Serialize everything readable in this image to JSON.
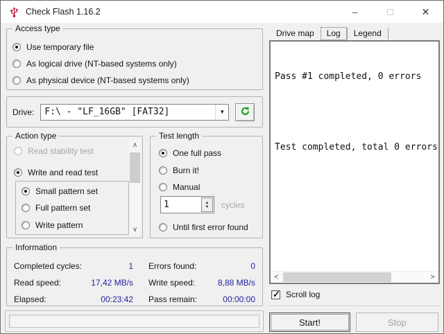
{
  "window": {
    "title": "Check Flash 1.16.2"
  },
  "icons": {
    "minimize": "–",
    "close": "✕",
    "dropdown": "▼",
    "spin_up": "▲",
    "spin_down": "▼",
    "scroll_up": "∧",
    "scroll_down": "∨",
    "scroll_left": "<",
    "scroll_right": ">",
    "check": "✓"
  },
  "colors": {
    "value_text": "#2222a6",
    "refresh_green": "#0ba10b",
    "app_icon_red": "#c2143c"
  },
  "access_type": {
    "title": "Access type",
    "options": [
      {
        "label": "Use temporary file",
        "selected": true
      },
      {
        "label": "As logical drive (NT-based systems only)",
        "selected": false
      },
      {
        "label": "As physical device (NT-based systems only)",
        "selected": false
      }
    ]
  },
  "drive": {
    "label": "Drive:",
    "selected_value": "F:\\ - \"LF_16GB\" [FAT32]"
  },
  "action_type": {
    "title": "Action type",
    "options": [
      {
        "label": "Read stability test",
        "selected": false,
        "disabled": true
      },
      {
        "label": "Write and read test",
        "selected": true,
        "disabled": false
      }
    ],
    "pattern_options": [
      {
        "label": "Small pattern set",
        "selected": true
      },
      {
        "label": "Full pattern set",
        "selected": false
      },
      {
        "label": "Write pattern",
        "selected": false
      }
    ]
  },
  "test_length": {
    "title": "Test length",
    "options": [
      {
        "label": "One full pass",
        "selected": true
      },
      {
        "label": "Burn it!",
        "selected": false
      },
      {
        "label": "Manual",
        "selected": false
      },
      {
        "label": "Until first error found",
        "selected": false
      }
    ],
    "cycles": {
      "value": "1",
      "unit": "cycles"
    }
  },
  "information": {
    "title": "Information",
    "rows": [
      {
        "label1": "Completed cycles:",
        "value1": "1",
        "label2": "Errors found:",
        "value2": "0"
      },
      {
        "label1": "Read speed:",
        "value1": "17,42 MB/s",
        "label2": "Write speed:",
        "value2": "8,88 MB/s"
      },
      {
        "label1": "Elapsed:",
        "value1": "00:23:42",
        "label2": "Pass remain:",
        "value2": "00:00:00"
      }
    ]
  },
  "tabs": [
    {
      "label": "Drive map",
      "selected": false
    },
    {
      "label": "Log",
      "selected": true
    },
    {
      "label": "Legend",
      "selected": false
    }
  ],
  "log": {
    "lines": [
      "Pass #1 completed, 0 errors",
      "",
      "Test completed, total 0 errors"
    ]
  },
  "scroll_log": {
    "label": "Scroll log",
    "checked": true
  },
  "buttons": {
    "start": "Start!",
    "stop": "Stop"
  }
}
